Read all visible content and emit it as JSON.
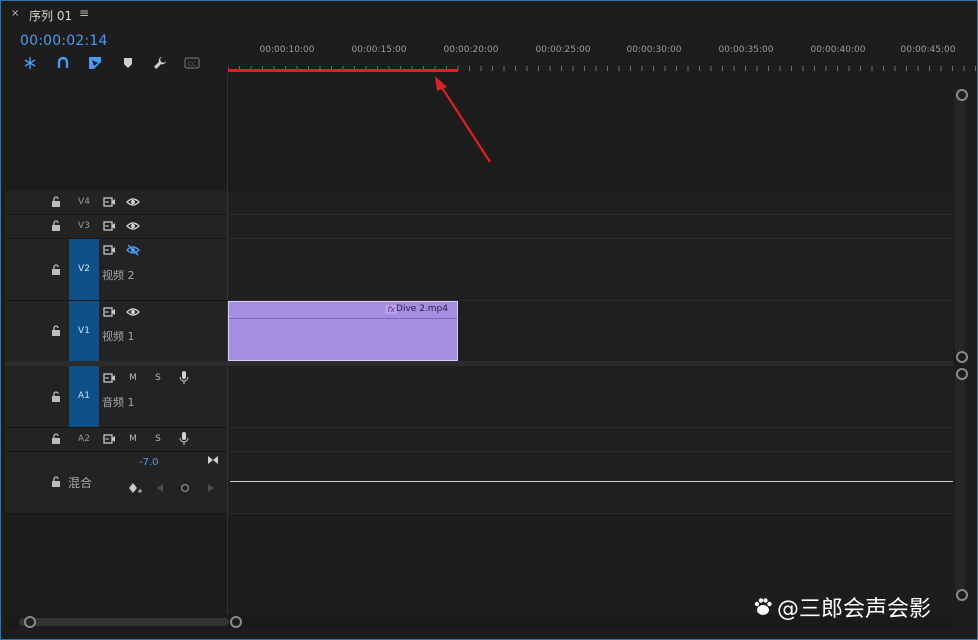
{
  "tab": {
    "close": "×",
    "title": "序列 01",
    "menu": "≡"
  },
  "timecode": "00:00:02:14",
  "tools": [
    "snap-icon",
    "magnet-icon",
    "linked-selection-icon",
    "marker-icon",
    "wrench-icon",
    "captions-icon"
  ],
  "ruler": {
    "labels": [
      "00:00:10:00",
      "00:00:15:00",
      "00:00:20:00",
      "00:00:25:00",
      "00:00:30:00",
      "00:00:35:00",
      "00:00:40:00",
      "00:00:45:00"
    ]
  },
  "tracks": {
    "v4": {
      "label": "V4"
    },
    "v3": {
      "label": "V3"
    },
    "v2": {
      "label": "V2",
      "name": "视频 2"
    },
    "v1": {
      "label": "V1",
      "name": "视频 1"
    },
    "a1": {
      "label": "A1",
      "name": "音频 1",
      "m": "M",
      "s": "S"
    },
    "a2": {
      "label": "A2",
      "m": "M",
      "s": "S"
    }
  },
  "mix": {
    "name": "混合",
    "value": "-7.0"
  },
  "clip": {
    "fx": "fx",
    "name": "Dive 2.mp4"
  },
  "watermark": "@三郎会声会影",
  "colors": {
    "accent": "#4a9df2",
    "clip": "#a48ee0",
    "work_area": "#e02020",
    "arrow": "#e02020"
  }
}
